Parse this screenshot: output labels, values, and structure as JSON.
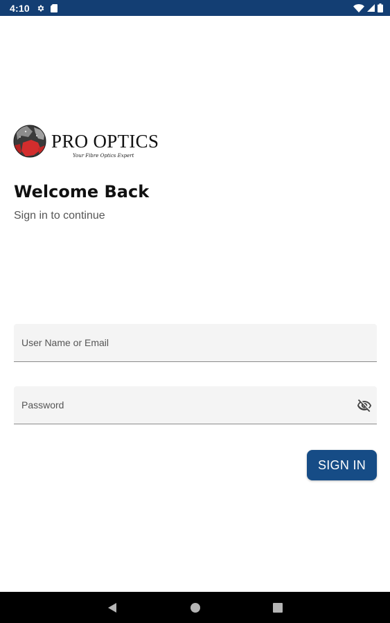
{
  "status_bar": {
    "time": "4:10",
    "left_icons": [
      "settings-icon",
      "sim-card-icon"
    ],
    "right_icons": [
      "wifi-icon",
      "cell-signal-icon",
      "battery-icon"
    ]
  },
  "logo": {
    "title": "PRO OPTICS",
    "tagline": "Your Fibre Optics Expert"
  },
  "welcome": {
    "title": "Welcome Back",
    "subtitle": "Sign in to continue"
  },
  "form": {
    "username": {
      "placeholder": "User Name or Email",
      "value": ""
    },
    "password": {
      "placeholder": "Password",
      "value": "",
      "toggle_icon": "visibility-off-icon"
    },
    "sign_in_label": "SIGN IN"
  },
  "nav_bar": {
    "buttons": [
      "back-icon",
      "home-icon",
      "recents-icon"
    ]
  },
  "colors": {
    "status_bar": "#133e73",
    "primary_button": "#164c86",
    "field_background": "#f4f4f4",
    "nav_bar": "#000000"
  }
}
